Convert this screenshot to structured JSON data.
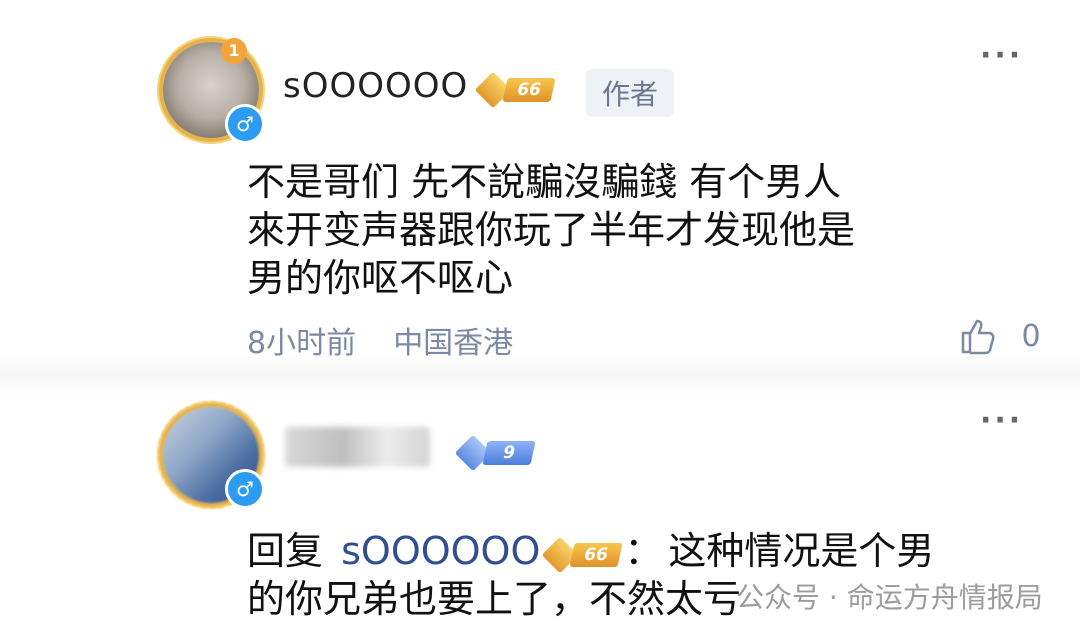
{
  "comment1": {
    "username": "sOOOOOO",
    "level": "66",
    "author_tag": "作者",
    "avatar_badge": "1",
    "gender_icon": "male-symbol-icon",
    "body": [
      "不是哥们 先不說騙沒騙錢 有个男人",
      "來开变声器跟你玩了半年才发现他是",
      "男的你呕不呕心"
    ],
    "time": "8小时前",
    "location": "中国香港",
    "like_count": "0",
    "more": "···"
  },
  "comment2": {
    "level": "9",
    "gender_icon": "male-symbol-icon",
    "reply_prefix": "回复",
    "reply_user": "sOOOOOO",
    "reply_user_level": "66",
    "reply_colon": "：",
    "body_line1": "这种情况是个男",
    "body_line2": "的你兄弟也要上了，不然太亏",
    "more": "···"
  },
  "watermark": "公众号 · 命运方舟情报局",
  "colors": {
    "link": "#2f4f91",
    "meta": "#7b8aa3",
    "gender": "#2b9cf2",
    "badge_gold": "#e8a436"
  }
}
